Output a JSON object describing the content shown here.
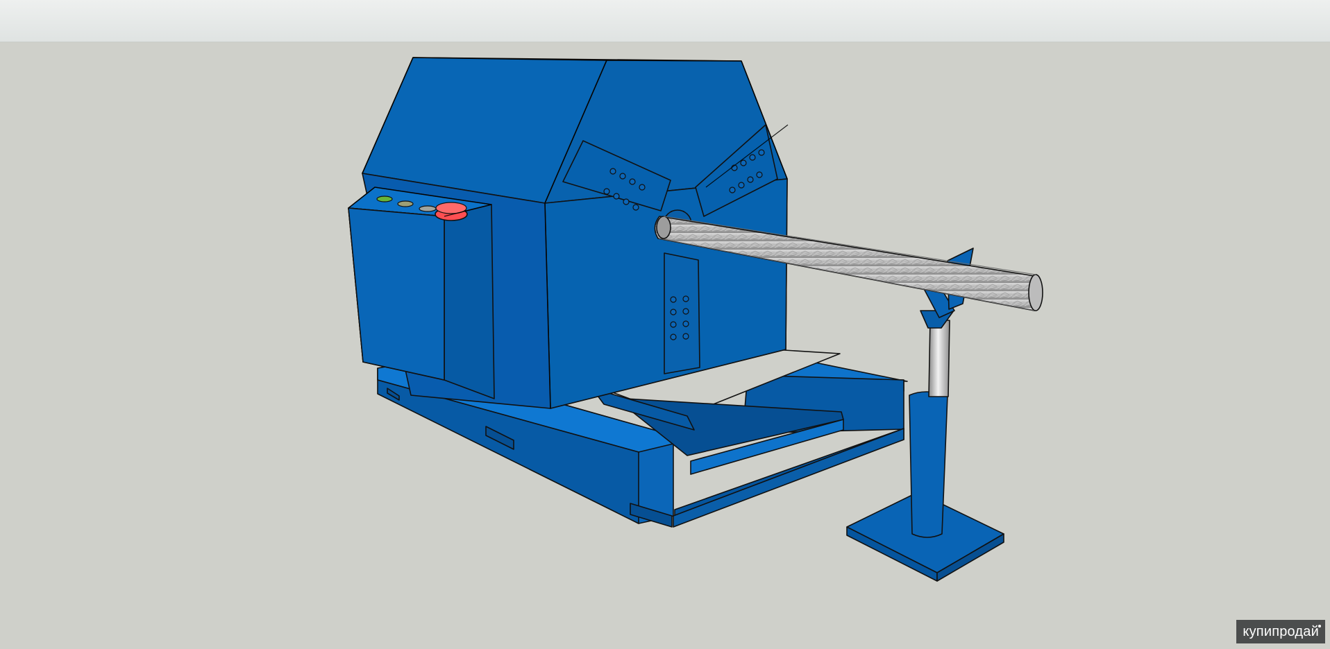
{
  "viewer": {
    "watermark_text": "купипродай"
  },
  "model": {
    "machine_color": "#0962ae",
    "machine_edge_color": "#0b4f94",
    "bar_color": "#a9a9a9",
    "button_colors": [
      "#67b53a",
      "#9b9f76",
      "#a2a49d",
      "#ff4f52"
    ]
  }
}
